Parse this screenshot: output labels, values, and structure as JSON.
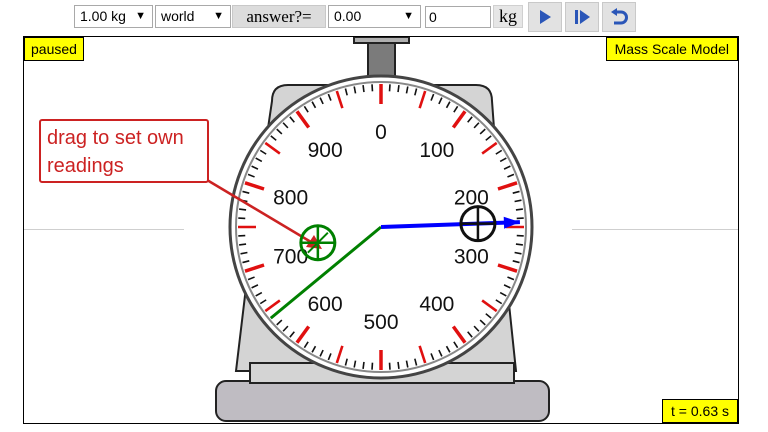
{
  "toolbar": {
    "mass_select": "1.00 kg",
    "frame_select": "world",
    "answer_label": "answer?=",
    "answer_select": "0.00",
    "value_input": "0",
    "unit_label": "kg"
  },
  "stage": {
    "status": "paused",
    "title": "Mass Scale Model",
    "time": "t = 0.63 s",
    "callout": [
      "drag to set own",
      "readings"
    ]
  },
  "dial": {
    "labels": [
      "0",
      "100",
      "200",
      "300",
      "400",
      "500",
      "600",
      "700",
      "800",
      "900"
    ],
    "red_needle_reading": 250,
    "green_needle_reading": 640,
    "needle_colors": {
      "red": "#0000ff",
      "green": "#008000",
      "tick": "#e01010",
      "callout": "#cc2222"
    }
  },
  "icons": [
    "play-icon",
    "step-icon",
    "reset-icon"
  ]
}
